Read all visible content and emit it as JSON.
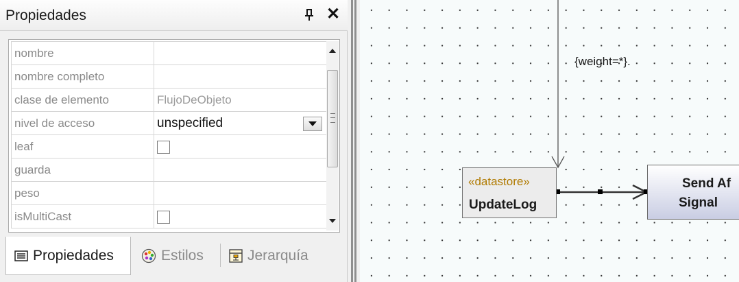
{
  "panel": {
    "title": "Propiedades",
    "pin_icon": "pin-icon",
    "close_icon": "close-icon",
    "close_label": "✕"
  },
  "properties": [
    {
      "name": "nombre",
      "value": ""
    },
    {
      "name": "nombre completo",
      "value": ""
    },
    {
      "name": "clase de elemento",
      "value": "FlujoDeObjeto"
    },
    {
      "name": "nivel de acceso",
      "value": "unspecified"
    },
    {
      "name": "leaf",
      "value": ""
    },
    {
      "name": "guarda",
      "value": ""
    },
    {
      "name": "peso",
      "value": ""
    },
    {
      "name": "isMultiCast",
      "value": ""
    }
  ],
  "tabs": [
    {
      "label": "Propiedades",
      "icon": "list-icon"
    },
    {
      "label": "Estilos",
      "icon": "palette-icon"
    },
    {
      "label": "Jerarquía",
      "icon": "hierarchy-icon"
    }
  ],
  "diagram": {
    "edge_label": "{weight=*}.",
    "datastore": {
      "stereotype": "«datastore»",
      "name": "UpdateLog"
    },
    "action": {
      "line1": "Send Af",
      "line2": "Signal"
    }
  },
  "colors": {
    "stereotype": "#b07a00",
    "action_fill_top": "#ffffff",
    "action_fill_bottom": "#c9cde3",
    "diagram_bg": "#f7fbfb"
  }
}
